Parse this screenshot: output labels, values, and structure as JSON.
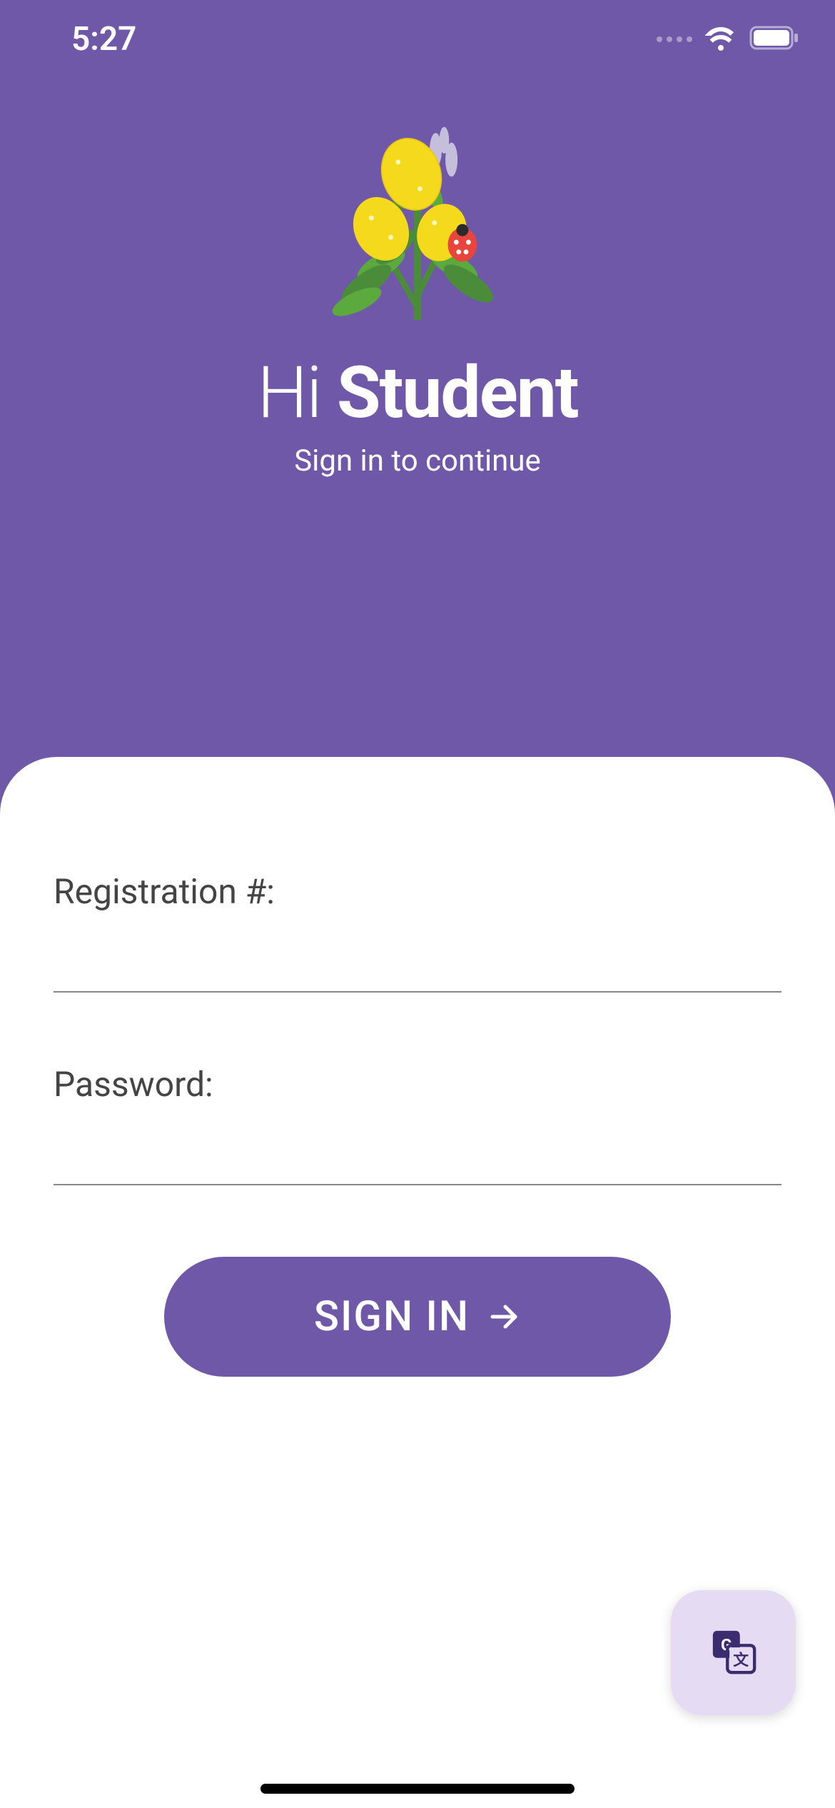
{
  "statusBar": {
    "time": "5:27"
  },
  "header": {
    "greeting_prefix": "Hi ",
    "greeting_name": "Student",
    "subtitle": "Sign in to continue"
  },
  "form": {
    "registration": {
      "label": "Registration #:",
      "value": ""
    },
    "password": {
      "label": "Password:",
      "value": ""
    },
    "signin_label": "SIGN IN"
  },
  "icons": {
    "logo": "lemon-branch-illustration",
    "arrow": "arrow-right-icon",
    "translate": "translate-icon"
  }
}
